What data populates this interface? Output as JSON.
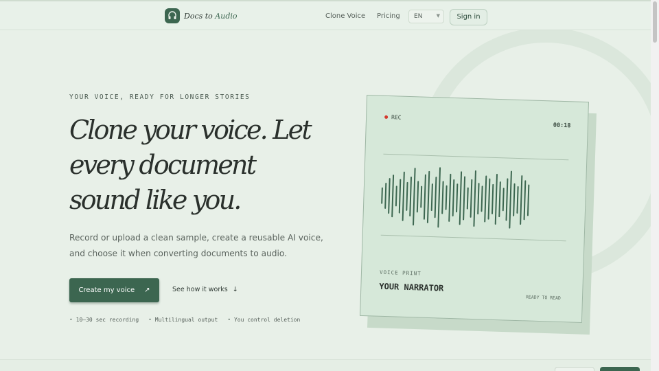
{
  "header": {
    "logo_text_a": "Docs to ",
    "logo_text_b": "Audio",
    "nav_clone": "Clone Voice",
    "nav_pricing": "Pricing",
    "lang": "EN",
    "signin": "Sign in"
  },
  "hero": {
    "eyebrow": "YOUR VOICE, READY FOR LONGER STORIES",
    "headline": "Clone your voice. Let every document sound like you.",
    "subtext": "Record or upload a clean sample, create a reusable AI voice, and choose it when converting documents to audio.",
    "cta": "Create my voice",
    "cta_icon": "arrow-up-right-icon",
    "secondary": "See how it works",
    "secondary_icon": "arrow-down-icon",
    "bullets": [
      "10–30 sec recording",
      "Multilingual output",
      "You control deletion"
    ]
  },
  "card": {
    "rec_label": "REC",
    "timer": "00:18",
    "voice_print_label": "VOICE PRINT",
    "narrator": "YOUR NARRATOR",
    "status": "READY TO READ"
  },
  "colors": {
    "brand": "#3c6650",
    "background": "#e8f0e8",
    "card": "#d6e8d9",
    "rec_dot": "#d43a2e"
  }
}
